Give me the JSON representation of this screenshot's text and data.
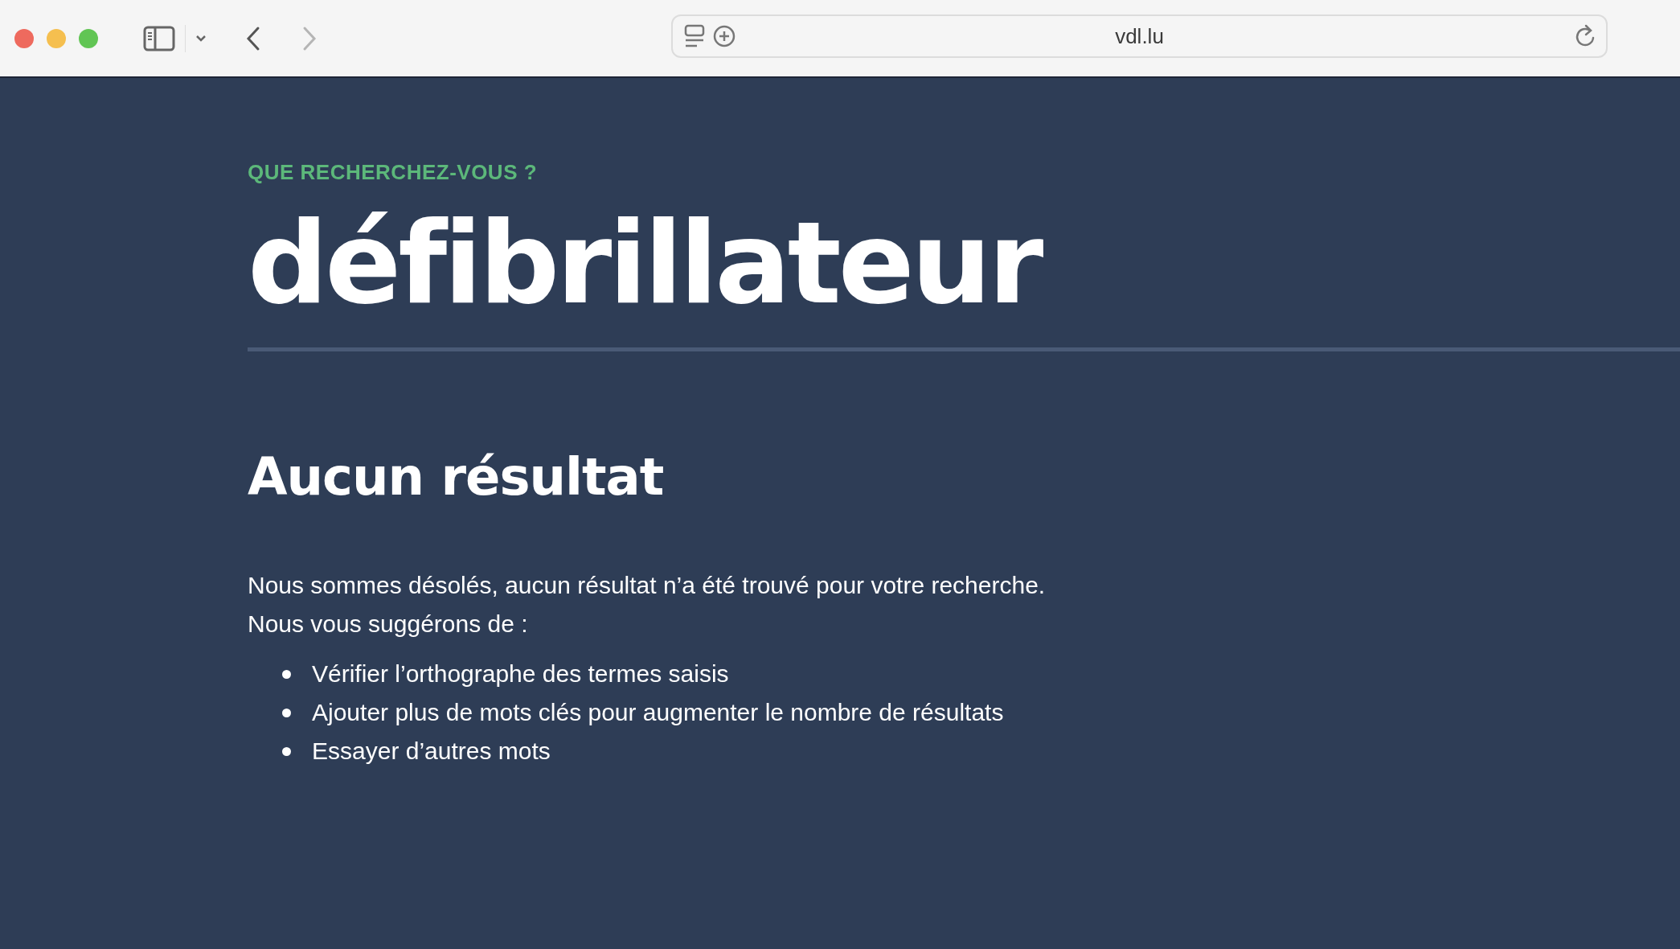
{
  "browser": {
    "url": "vdl.lu"
  },
  "search": {
    "label": "QUE RECHERCHEZ-VOUS ?",
    "query": "défibrillateur"
  },
  "results": {
    "heading": "Aucun résultat",
    "message": [
      "Nous sommes désolés, aucun résultat n’a été trouvé pour votre recherche.",
      "Nous vous suggérons de :"
    ],
    "suggestions": [
      "Vérifier l’orthographe des termes saisis",
      "Ajouter plus de mots clés pour augmenter le nombre de résultats",
      "Essayer d’autres mots"
    ]
  }
}
